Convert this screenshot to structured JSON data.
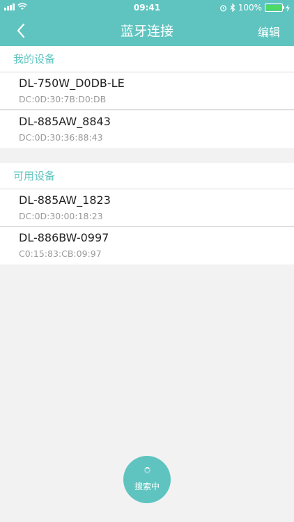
{
  "status_bar": {
    "time": "09:41",
    "battery": "100%",
    "battery_level": 1.0
  },
  "nav": {
    "title": "蓝牙连接",
    "edit": "编辑"
  },
  "my_devices": {
    "header": "我的设备",
    "items": [
      {
        "name": "DL-750W_D0DB-LE",
        "mac": "DC:0D:30:7B:D0:DB"
      },
      {
        "name": "DL-885AW_8843",
        "mac": "DC:0D:30:36:88:43"
      }
    ]
  },
  "available_devices": {
    "header": "可用设备",
    "items": [
      {
        "name": "DL-885AW_1823",
        "mac": "DC:0D:30:00:18:23"
      },
      {
        "name": "DL-886BW-0997",
        "mac": "C0:15:83:CB:09:97"
      }
    ]
  },
  "search_button": {
    "label": "搜索中"
  },
  "colors": {
    "accent": "#5fc4c0",
    "background": "#f2f2f2"
  }
}
